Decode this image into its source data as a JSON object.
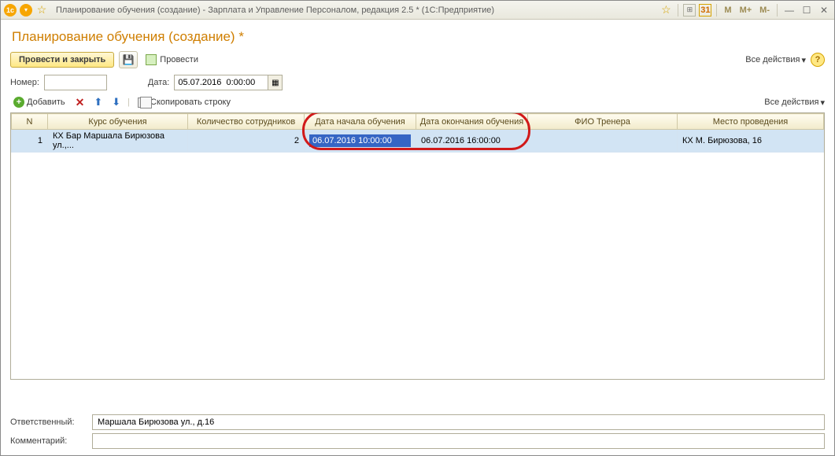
{
  "titlebar": {
    "title": "Планирование обучения (создание) - Зарплата и Управление Персоналом, редакция 2.5 *  (1С:Предприятие)"
  },
  "page": {
    "title": "Планирование обучения (создание) *"
  },
  "commands": {
    "submit_close": "Провести и закрыть",
    "post": "Провести",
    "all_actions": "Все действия"
  },
  "fields": {
    "number_label": "Номер:",
    "number_value": "",
    "date_label": "Дата:",
    "date_value": "05.07.2016  0:00:00"
  },
  "table_cmd": {
    "add": "Добавить",
    "copy": "Скопировать строку",
    "all_actions": "Все действия"
  },
  "table": {
    "headers": {
      "n": "N",
      "course": "Курс обучения",
      "count": "Количество сотрудников",
      "start": "Дата начала обучения",
      "end": "Дата окончания обучения",
      "trainer": "ФИО Тренера",
      "place": "Место проведения"
    },
    "rows": [
      {
        "n": "1",
        "course": "КХ Бар Маршала Бирюзова ул.,...",
        "count": "2",
        "start": "06.07.2016 10:00:00",
        "end": "06.07.2016 16:00:00",
        "trainer": "",
        "place": "КХ М. Бирюзова, 16"
      }
    ]
  },
  "bottom": {
    "responsible_label": "Ответственный:",
    "responsible_value": "Маршала Бирюзова ул., д.16",
    "comment_label": "Комментарий:",
    "comment_value": ""
  }
}
